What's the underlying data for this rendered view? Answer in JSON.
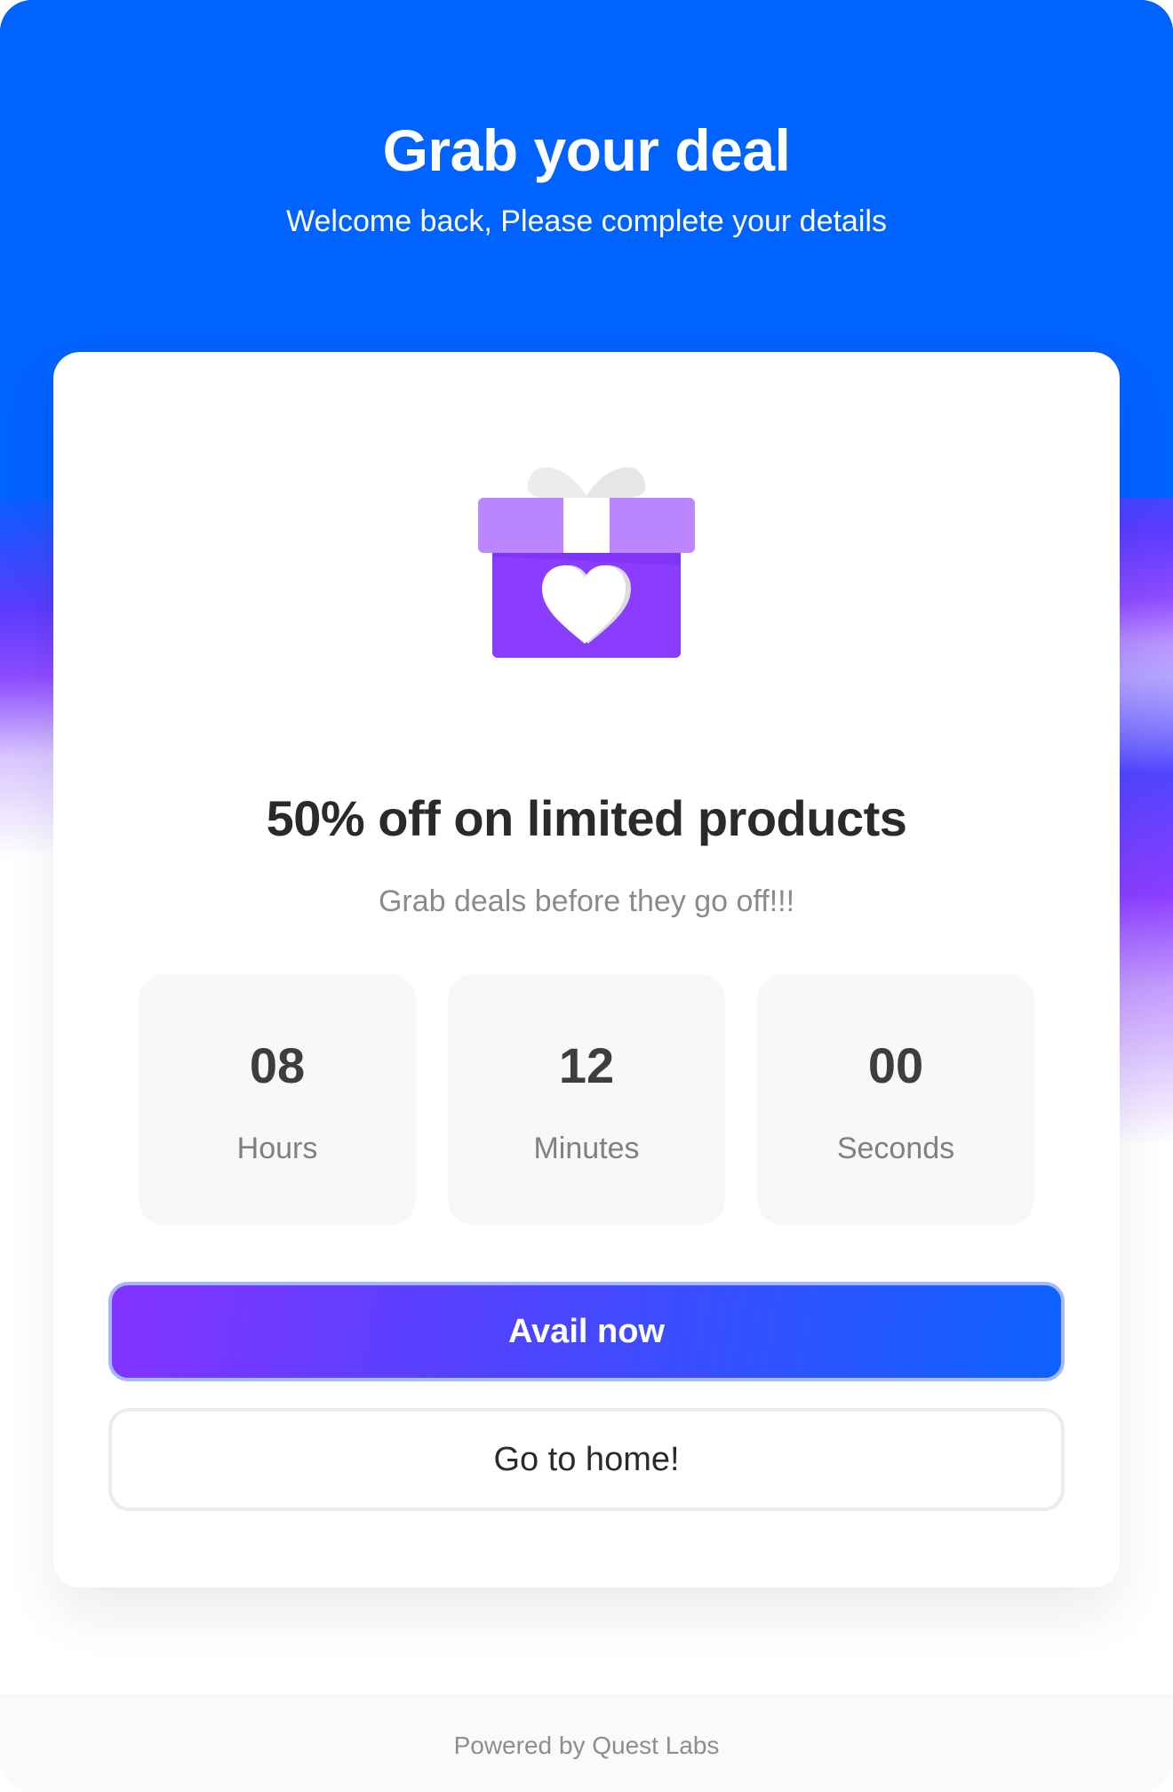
{
  "header": {
    "title": "Grab your deal",
    "subtitle": "Welcome back, Please complete your details"
  },
  "offer": {
    "icon": "gift-icon",
    "headline": "50% off on limited products",
    "subline": "Grab deals before they go off!!!"
  },
  "countdown": [
    {
      "value": "08",
      "label": "Hours"
    },
    {
      "value": "12",
      "label": "Minutes"
    },
    {
      "value": "00",
      "label": "Seconds"
    }
  ],
  "actions": {
    "primary_label": "Avail now",
    "secondary_label": "Go to home!"
  },
  "footer": {
    "text": "Powered by Quest Labs"
  },
  "colors": {
    "brand_blue": "#0062ff",
    "brand_purple": "#8433ff",
    "gift_purple": "#8a3cff",
    "gift_lid": "#bb86ff"
  }
}
